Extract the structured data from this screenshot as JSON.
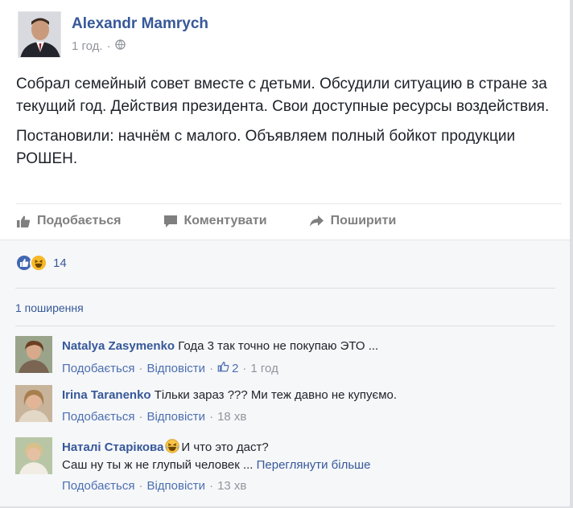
{
  "post": {
    "author": "Alexandr Mamrych",
    "time": "1 год.",
    "separator": "·",
    "paragraphs": [
      "Собрал семейный совет вместе с детьми. Обсудили ситуацию в стране за текущий год. Действия президента. Свои доступные ресурсы воздействия.",
      "Постановили: начнём с малого. Объявляем полный бойкот продукции РОШЕН."
    ],
    "actions": {
      "like": "Подобається",
      "comment": "Коментувати",
      "share": "Поширити"
    }
  },
  "feedback": {
    "reaction_count": "14",
    "shares": "1 поширення"
  },
  "comments": [
    {
      "author": "Natalya Zasymenko",
      "text": "Года 3 так точно не покупаю ЭТО ...",
      "more": "",
      "like_label": "Подобається",
      "reply_label": "Відповісти",
      "likes": "2",
      "time": "1 год"
    },
    {
      "author": "Irina Taranenko",
      "text": "Тільки зараз ??? Ми теж давно не купуємо.",
      "more": "",
      "like_label": "Подобається",
      "reply_label": "Відповісти",
      "time": "18 хв"
    },
    {
      "author": "Наталі Старікова",
      "text_line1": "И что это даст?",
      "text_line2": "Саш ну ты ж не глупый человек ...",
      "more": "Переглянути більше",
      "like_label": "Подобається",
      "reply_label": "Відповісти",
      "time": "13 хв"
    }
  ],
  "colors": {
    "link": "#365899",
    "meta": "#90949c",
    "text": "#1d2129",
    "feedback_bg": "#f6f7f9",
    "like_blue": "#4267b2",
    "haha_yellow": "#f7b928"
  },
  "icons": {
    "public": "globe-icon",
    "like": "thumbs-up-icon",
    "comment": "speech-bubble-icon",
    "share": "share-arrow-icon",
    "reaction_like": "like-reaction-icon",
    "reaction_haha": "haha-reaction-icon",
    "laugh_emoji": "laughing-emoji-icon"
  }
}
